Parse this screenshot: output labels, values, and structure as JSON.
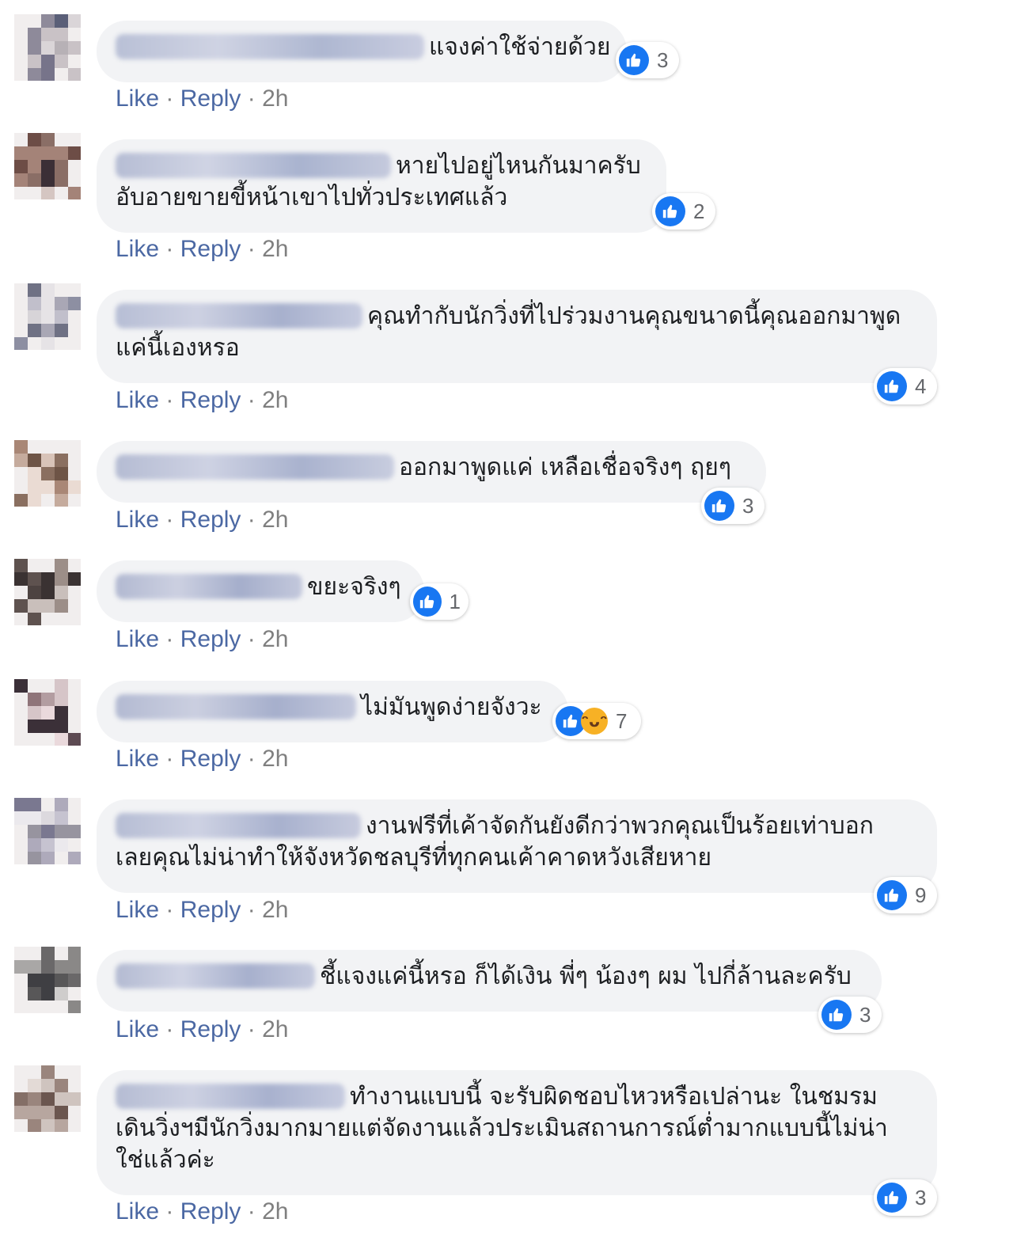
{
  "labels": {
    "like": "Like",
    "reply": "Reply",
    "sep": "·"
  },
  "colors": {
    "like_blue": "#1877f2",
    "bubble": "#f2f3f5",
    "action_link": "#4b68a3"
  },
  "comments": [
    {
      "lines": [
        "แจงค่าใช้จ่ายด้วย"
      ],
      "reactions": [
        "like-icon"
      ],
      "count": "3",
      "time": "2h"
    },
    {
      "lines": [
        "หายไปอยู่ไหนกันมาครับ",
        "อับอายขายขี้หน้าเขาไปทั่วประเทศแล้ว"
      ],
      "reactions": [
        "like-icon"
      ],
      "count": "2",
      "time": "2h"
    },
    {
      "lines": [
        "คุณทำกับนักวิ่งที่ไปร่วมงานคุณขนาดนี้คุณออกมาพูด",
        "แค่นี้เองหรอ"
      ],
      "reactions": [
        "like-icon"
      ],
      "count": "4",
      "time": "2h"
    },
    {
      "lines": [
        "ออกมาพูดแค่ เหลือเชื่อจริงๆ ฤยๆ"
      ],
      "reactions": [
        "like-icon"
      ],
      "count": "3",
      "time": "2h"
    },
    {
      "lines": [
        "ขยะจริงๆ"
      ],
      "reactions": [
        "like-icon"
      ],
      "count": "1",
      "time": "2h"
    },
    {
      "lines": [
        "ไม่มันพูดง่ายจังวะ"
      ],
      "reactions": [
        "like-icon",
        "haha-icon"
      ],
      "count": "7",
      "time": "2h"
    },
    {
      "lines": [
        "งานฟรีที่เค้าจัดกันยังดีกว่าพวกคุณเป็นร้อยเท่าบอก",
        "เลยคุณไม่น่าทำให้จังหวัดชลบุรีที่ทุกคนเค้าคาดหวังเสียหาย"
      ],
      "reactions": [
        "like-icon"
      ],
      "count": "9",
      "time": "2h"
    },
    {
      "lines": [
        "ชี้แจงแค่นี้หรอ ก็ได้เงิน พี่ๆ น้องๆ ผม ไปกี่ล้านละครับ"
      ],
      "reactions": [
        "like-icon"
      ],
      "count": "3",
      "time": "2h"
    },
    {
      "lines": [
        "ทำงานแบบนี้ จะรับผิดชอบไหวหรือเปล่านะ ในชมรม",
        "เดินวิ่งฯมีนักวิ่งมากมายแต่จัดงานแล้วประเมินสถานการณ์ต่ำมากแบบนี้ไม่น่า",
        "ใช่แล้วค่ะ"
      ],
      "reactions": [
        "like-icon"
      ],
      "count": "3",
      "time": "2h"
    }
  ]
}
